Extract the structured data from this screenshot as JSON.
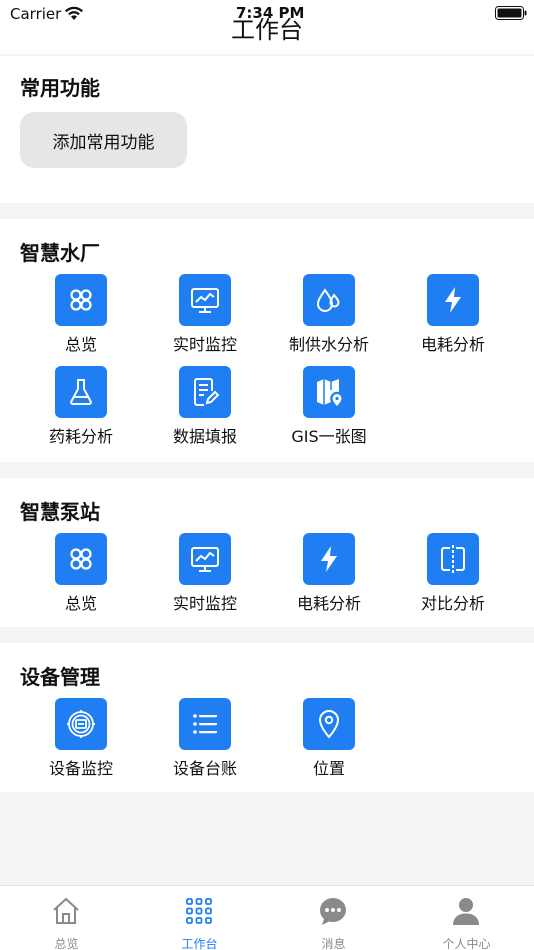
{
  "status_bar": {
    "carrier": "Carrier",
    "time": "7:34 PM"
  },
  "header": {
    "title": "工作台"
  },
  "colors": {
    "accent": "#1e7ef2",
    "inactive": "#8a8a8a"
  },
  "common": {
    "title": "常用功能",
    "add_label": "添加常用功能"
  },
  "water_plant": {
    "title": "智慧水厂",
    "items": [
      {
        "label": "总览",
        "icon": "grid-overview-icon"
      },
      {
        "label": "实时监控",
        "icon": "monitor-chart-icon"
      },
      {
        "label": "制供水分析",
        "icon": "water-drops-icon"
      },
      {
        "label": "电耗分析",
        "icon": "lightning-icon"
      },
      {
        "label": "药耗分析",
        "icon": "flask-icon"
      },
      {
        "label": "数据填报",
        "icon": "form-edit-icon"
      },
      {
        "label": "GIS一张图",
        "icon": "map-pin-icon"
      }
    ]
  },
  "pump_station": {
    "title": "智慧泵站",
    "items": [
      {
        "label": "总览",
        "icon": "grid-overview-icon"
      },
      {
        "label": "实时监控",
        "icon": "monitor-chart-icon"
      },
      {
        "label": "电耗分析",
        "icon": "lightning-icon"
      },
      {
        "label": "对比分析",
        "icon": "compare-icon"
      }
    ]
  },
  "device": {
    "title": "设备管理",
    "items": [
      {
        "label": "设备监控",
        "icon": "device-monitor-icon"
      },
      {
        "label": "设备台账",
        "icon": "list-icon"
      },
      {
        "label": "位置",
        "icon": "location-icon"
      }
    ]
  },
  "tabs": [
    {
      "label": "总览",
      "icon": "home-icon",
      "active": false
    },
    {
      "label": "工作台",
      "icon": "apps-grid-icon",
      "active": true
    },
    {
      "label": "消息",
      "icon": "message-icon",
      "active": false
    },
    {
      "label": "个人中心",
      "icon": "person-icon",
      "active": false
    }
  ]
}
